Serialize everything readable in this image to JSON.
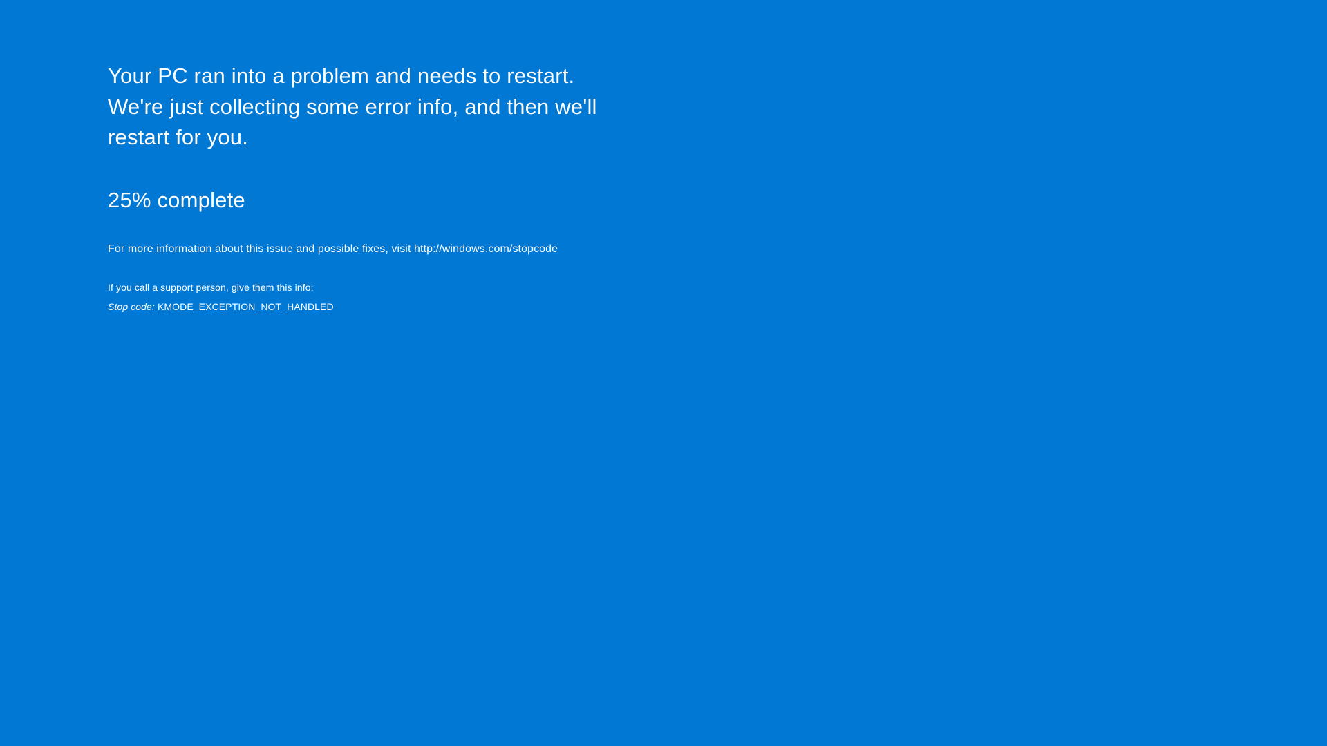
{
  "colors": {
    "background": "#0078d4",
    "text": "#ffffff"
  },
  "bsod": {
    "main_message": "Your PC ran into a problem and needs to restart. We're just collecting some error info, and then we'll restart for you.",
    "progress_percent": 25,
    "progress_text": "25% complete",
    "info_link_text": "For more information about this issue and possible fixes, visit http://windows.com/stopcode",
    "support_intro": "If you call a support person, give them this info:",
    "stop_code_label": "Stop code:",
    "stop_code_value": "KMODE_EXCEPTION_NOT_HANDLED"
  }
}
